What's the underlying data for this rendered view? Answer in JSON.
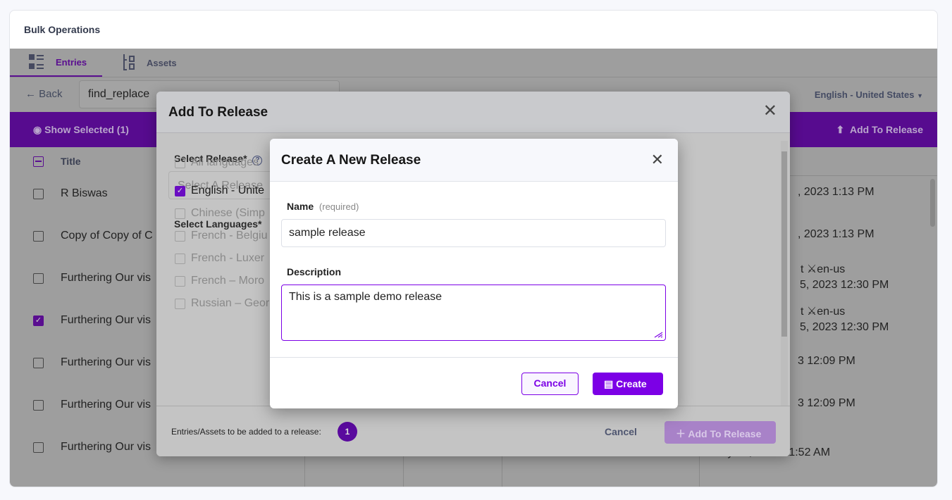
{
  "page": {
    "title": "Bulk Operations"
  },
  "tabs": [
    {
      "label": "Entries",
      "active": true,
      "icon": "entries-list-icon"
    },
    {
      "label": "Assets",
      "icon": "assets-icon"
    }
  ],
  "toolbar": {
    "back_label": "Back",
    "search_value": "find_replace",
    "locale": "English - United States"
  },
  "action_bar": {
    "show_selected": "Show Selected (1)",
    "add_to_release": "Add To Release"
  },
  "table": {
    "header_title": "Title",
    "rows": [
      {
        "title": "R Biswas",
        "checked": false,
        "date": ", 2023 1:13 PM"
      },
      {
        "title": "Copy of Copy of C",
        "checked": false,
        "date": ", 2023 1:13 PM"
      },
      {
        "title": "Furthering Our vis",
        "checked": false,
        "locale": "t  ⚔en-us",
        "date": "5, 2023 12:30 PM"
      },
      {
        "title": "Furthering Our vis",
        "checked": true,
        "locale": "t  ⚔en-us",
        "date": "5, 2023 12:30 PM"
      },
      {
        "title": "Furthering Our vis",
        "checked": false,
        "date": "3 12:09 PM"
      },
      {
        "title": "Furthering Our vis",
        "checked": false,
        "date": "3 12:09 PM"
      },
      {
        "title": "Furthering Our vis",
        "checked": false,
        "date": "July 19, 2023 11:52 AM"
      }
    ]
  },
  "add_modal": {
    "title": "Add To Release",
    "select_release_label": "Select Release*",
    "select_release_placeholder": "Select A Release",
    "select_languages_label": "Select Languages*",
    "languages": [
      {
        "label": "All languages",
        "checked": false
      },
      {
        "label": "English - Unite",
        "checked": true
      },
      {
        "label": "Chinese (Simp",
        "checked": false
      },
      {
        "label": "French - Belgiu",
        "checked": false
      },
      {
        "label": "French - Luxer",
        "checked": false
      },
      {
        "label": "French – Moro",
        "checked": false
      },
      {
        "label": "Russian – Geor",
        "checked": false
      }
    ],
    "footer_text": "Entries/Assets to be added to a release:",
    "count": "1",
    "cancel": "Cancel",
    "submit": "Add To Release"
  },
  "create_modal": {
    "title": "Create A New Release",
    "name_label": "Name",
    "name_hint": "(required)",
    "name_value": "sample release",
    "description_label": "Description",
    "description_value": "This is a sample demo release",
    "cancel": "Cancel",
    "create": "Create"
  },
  "colors": {
    "accent": "#7c00e6",
    "accent_dimmed": "#570b8f"
  }
}
